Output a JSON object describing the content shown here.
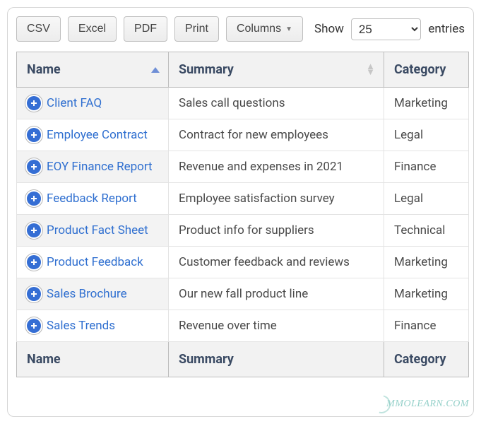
{
  "toolbar": {
    "csv": "CSV",
    "excel": "Excel",
    "pdf": "PDF",
    "print": "Print",
    "columns": "Columns",
    "show_label": "Show",
    "page_length_value": "25",
    "entries_label": "entries"
  },
  "columns": {
    "name": "Name",
    "summary": "Summary",
    "category": "Category"
  },
  "rows": [
    {
      "name": "Client FAQ",
      "summary": "Sales call questions",
      "category": "Marketing"
    },
    {
      "name": "Employee Contract",
      "summary": "Contract for new employees",
      "category": "Legal"
    },
    {
      "name": "EOY Finance Report",
      "summary": "Revenue and expenses in 2021",
      "category": "Finance"
    },
    {
      "name": "Feedback Report",
      "summary": "Employee satisfaction survey",
      "category": "Legal"
    },
    {
      "name": "Product Fact Sheet",
      "summary": "Product info for suppliers",
      "category": "Technical"
    },
    {
      "name": "Product Feedback",
      "summary": "Customer feedback and reviews",
      "category": "Marketing"
    },
    {
      "name": "Sales Brochure",
      "summary": "Our new fall product line",
      "category": "Marketing"
    },
    {
      "name": "Sales Trends",
      "summary": "Revenue over time",
      "category": "Finance"
    }
  ],
  "watermark": "MMOLEARN.COM"
}
